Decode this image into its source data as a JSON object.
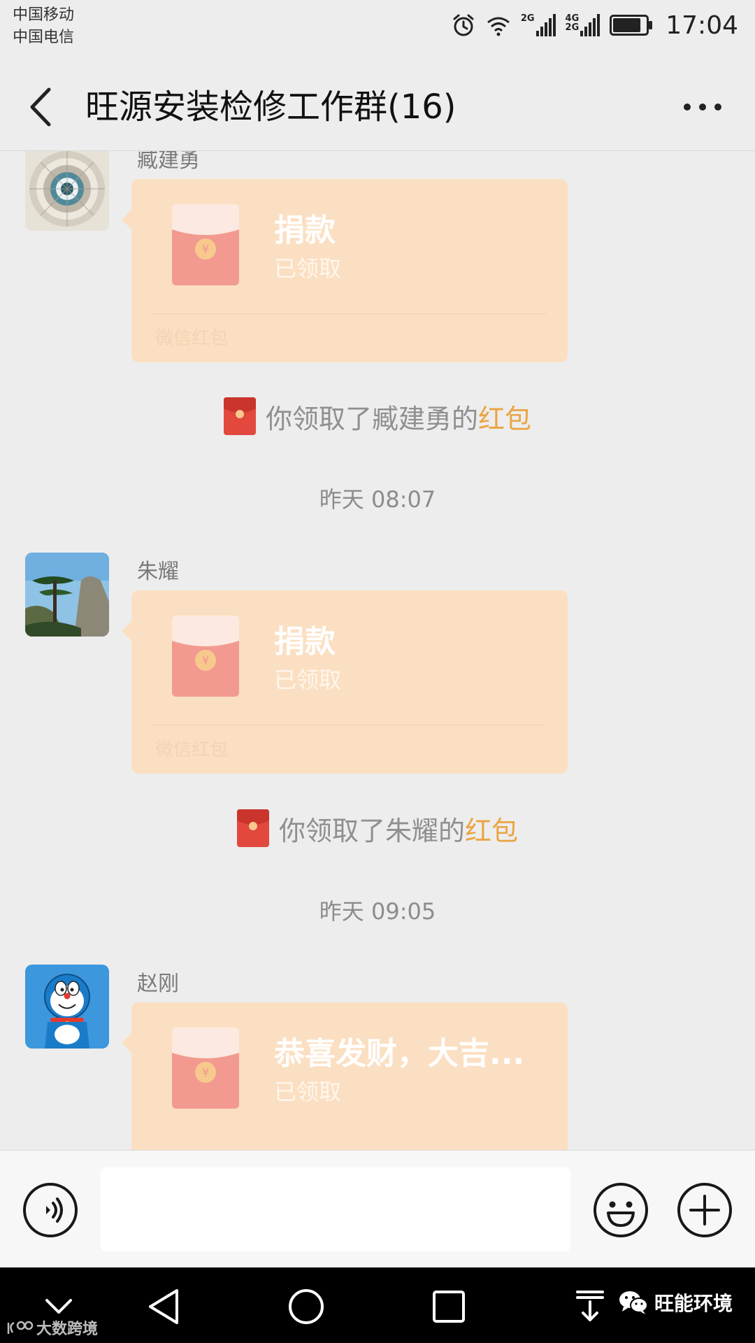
{
  "status_bar": {
    "carrier_1": "中国移动",
    "carrier_2": "中国电信",
    "sim1_network": "2G",
    "sim2_network_top": "4G",
    "sim2_network_bottom": "2G",
    "battery_level": 0.85,
    "time": "17:04",
    "icons": [
      "alarm-icon",
      "wifi-icon",
      "signal-icon",
      "battery-icon"
    ]
  },
  "header": {
    "title": "旺源安装检修工作群(16)",
    "back_icon": "back-arrow-icon",
    "more_icon": "more-dots-icon"
  },
  "chat": {
    "messages": [
      {
        "sender": "臧建勇",
        "avatar": "spiral-staircase-avatar",
        "packet_title": "捐款",
        "packet_status": "已领取",
        "packet_footer": "微信红包",
        "system_prefix": "你领取了臧建勇的",
        "system_link": "红包"
      },
      {
        "time": "昨天 08:07",
        "sender": "朱耀",
        "avatar": "pine-mountain-avatar",
        "packet_title": "捐款",
        "packet_status": "已领取",
        "packet_footer": "微信红包",
        "system_prefix": "你领取了朱耀的",
        "system_link": "红包"
      },
      {
        "time": "昨天 09:05",
        "sender": "赵刚",
        "avatar": "doraemon-avatar",
        "packet_title": "恭喜发财，大吉...",
        "packet_status": "已领取"
      }
    ]
  },
  "input_bar": {
    "voice_icon": "voice-icon",
    "text_value": "",
    "emoji_icon": "emoji-icon",
    "plus_icon": "plus-icon"
  },
  "nav_bar": {
    "icons": [
      "collapse-icon",
      "back-triangle-icon",
      "home-circle-icon",
      "recents-square-icon",
      "pull-down-icon"
    ]
  },
  "watermarks": {
    "left": "大数跨境",
    "right": "旺能环境"
  },
  "colors": {
    "background": "#ededed",
    "packet": "#fbdfc2",
    "envelope": "#f29a8f",
    "link": "#eba442"
  }
}
